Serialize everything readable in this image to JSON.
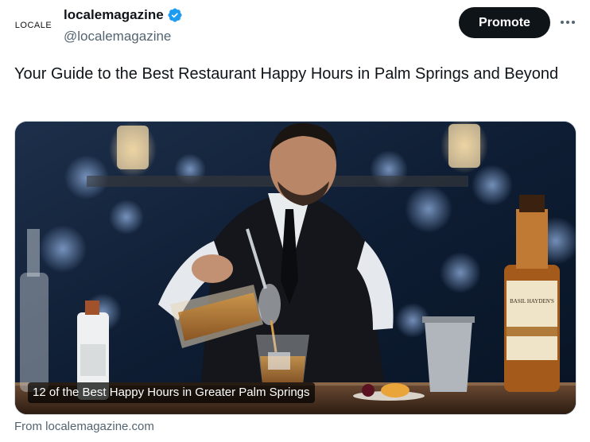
{
  "author": {
    "avatar_text": "LOCALE",
    "display_name": "localemagazine",
    "handle": "@localemagazine",
    "verified_icon": "verified-badge-icon",
    "verified_color": "#1d9bf0"
  },
  "actions": {
    "promote_label": "Promote",
    "more_icon": "more-horizontal-icon"
  },
  "tweet": {
    "text": "Your Guide to the Best Restaurant Happy Hours in Palm Springs and Beyond"
  },
  "card": {
    "caption": "12 of the Best Happy Hours in Greater Palm Springs",
    "source": "From localemagazine.com",
    "image_labels": {
      "whiskey_label": "BASIL HAYDEN'S"
    }
  },
  "colors": {
    "text_primary": "#0f1419",
    "text_secondary": "#536471",
    "button_dark": "#0f1419"
  }
}
